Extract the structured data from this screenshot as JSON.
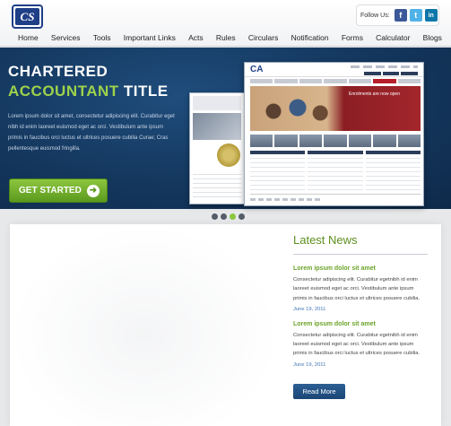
{
  "logo": {
    "text": "CS"
  },
  "follow": {
    "label": "Follow Us:",
    "icons": [
      "facebook-icon",
      "twitter-icon",
      "linkedin-icon"
    ],
    "facebook": "f",
    "twitter": "t",
    "linkedin": "in"
  },
  "nav": {
    "items": [
      "Home",
      "Services",
      "Tools",
      "Important Links",
      "Acts",
      "Rules",
      "Circulars",
      "Notification",
      "Forms",
      "Calculator",
      "Blogs"
    ]
  },
  "hero": {
    "line1": "CHARTERED",
    "line2_accent": "ACCOUNTANT",
    "line2_white": "TITLE",
    "body": "Lorem ipsum dolor sit amet, consectetur adipiscing elit. Curabitur eget nibh id enim laoreet euismod eget ac orci. Vestibulum ante ipsum primis in faucibus orci luctus et ultrices posuere cubilia Curae; Cras pellentesque euismod fringilla.",
    "cta_label": "GET STARTED",
    "preview_logo": "CA",
    "preview_banner": "Enrolments are now open"
  },
  "carousel": {
    "dots": 4,
    "active_index": 2
  },
  "news": {
    "title": "Latest News",
    "items": [
      {
        "title": "Lorem ipsum dolor sit amet",
        "body": "Consectetur adipiscing elit. Curabitur egetnibh id enim laoreet euismod eget ac orci. Vestibulum ante ipsum primis in faucibus orci luctus et ultrices posuere cubilia.",
        "date": "June 19, 2011"
      },
      {
        "title": "Lorem ipsum dolor sit amet",
        "body": "Consectetur adipiscing elit. Curabitur egetnibh id enim laoreet euismod eget ac orci. Vestibulum ante ipsum primis in faucibus orci luctus et ultrices posuere cubilia.",
        "date": "June 19, 2011"
      }
    ],
    "more_label": "Read More"
  },
  "colors": {
    "brand": "#1f3f86",
    "accent": "#8dc63f",
    "hero_bg": "#14375e",
    "link": "#3d74b5"
  }
}
